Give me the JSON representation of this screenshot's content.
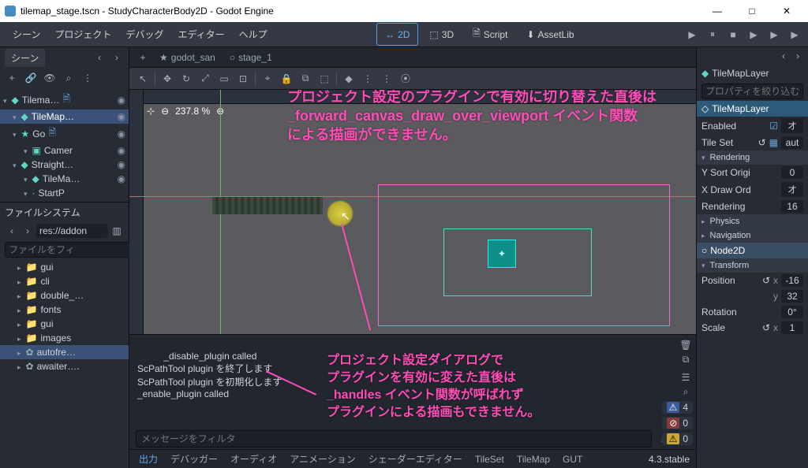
{
  "title": "tilemap_stage.tscn - StudyCharacterBody2D - Godot Engine",
  "window_controls": {
    "min": "—",
    "max": "□",
    "close": "✕"
  },
  "menu": [
    "シーン",
    "プロジェクト",
    "デバッグ",
    "エディター",
    "ヘルプ"
  ],
  "modes": {
    "d2": "2D",
    "d3": "3D",
    "script": "Script",
    "assetlib": "AssetLib"
  },
  "play_icons": [
    "▶",
    "⏸",
    "■",
    "▶",
    "▶",
    "▶"
  ],
  "scene_dock": {
    "tab": "シーン",
    "tools": [
      "+",
      "🔗",
      "👁",
      "⌕",
      "⋮"
    ],
    "tree": [
      {
        "icon": "◆",
        "label": "Tilema…",
        "indent": 0,
        "script": true,
        "eye": true
      },
      {
        "icon": "◆",
        "label": "TileMap…",
        "indent": 1,
        "sel": true,
        "eye": true
      },
      {
        "icon": "★",
        "label": "Go",
        "indent": 1,
        "script": true,
        "eye": true
      },
      {
        "icon": "▣",
        "label": "Camer",
        "indent": 2,
        "eye": true
      },
      {
        "icon": "◆",
        "label": "Straight…",
        "indent": 1,
        "eye": true
      },
      {
        "icon": "◆",
        "label": "TileMa…",
        "indent": 2,
        "eye": true
      },
      {
        "icon": "·",
        "label": "StartP",
        "indent": 2
      }
    ]
  },
  "fs_dock": {
    "title": "ファイルシステム",
    "path": "res://addon",
    "filter_ph": "ファイルをフィ",
    "items": [
      {
        "t": "folder",
        "label": "gui",
        "open": true
      },
      {
        "t": "folder",
        "label": "cli"
      },
      {
        "t": "folder",
        "label": "double_…"
      },
      {
        "t": "folder",
        "label": "fonts"
      },
      {
        "t": "folder",
        "label": "gui"
      },
      {
        "t": "folder",
        "label": "images"
      },
      {
        "t": "file",
        "label": "autofre…",
        "sel": true
      },
      {
        "t": "file",
        "label": "awaiter…."
      }
    ]
  },
  "center_tabs": [
    {
      "icon": "★",
      "label": "godot_san"
    },
    {
      "icon": "○",
      "label": "stage_1"
    }
  ],
  "vp_tools": [
    "↖",
    "✥",
    "↻",
    "⤢",
    "▭",
    "⊡",
    "⌖",
    "🔒",
    "⧉",
    "⬚",
    "◆",
    "⋮",
    "⋮",
    "⦿"
  ],
  "vp_zoom": {
    "minus": "⊖",
    "pct": "237.8 %",
    "plus": "⊕",
    "center": "⊹"
  },
  "annotation_top": "プロジェクト設定のプラグインで有効に切り替えた直後は\n_forward_canvas_draw_over_viewport イベント関数\nによる描画ができません。",
  "annotation_mid": "プロジェクト設定ダイアログで\nプラグインを有効に変えた直後は\n_handles イベント関数が呼ばれず\nプラグインによる描画もできません。",
  "output": {
    "lines": "_disable_plugin called\nScPathTool plugin を終了します\nScPathTool plugin を初期化します\n_enable_plugin called",
    "filter_ph": "メッセージをフィルタ",
    "badges": [
      {
        "icon": "⚠",
        "color": "#fff",
        "bg": "#3b5b9c",
        "label": "4"
      },
      {
        "icon": "⊘",
        "color": "#fff",
        "bg": "#8a3a3a",
        "label": "0"
      },
      {
        "icon": "⚠",
        "color": "#000",
        "bg": "#caa832",
        "label": "0"
      }
    ],
    "footer": [
      "出力",
      "デバッガー",
      "オーディオ",
      "アニメーション",
      "シェーダーエディター",
      "TileSet",
      "TileMap",
      "GUT"
    ],
    "version": "4.3.stable"
  },
  "inspector": {
    "tab_icon": "◆",
    "title": "TileMapLayer",
    "filter_ph": "プロパティを絞り込む",
    "class_header": "TileMapLayer",
    "rows_top": [
      {
        "label": "Enabled",
        "ctl": "check",
        "val": "オ"
      },
      {
        "label": "Tile Set",
        "ctl": "res",
        "val": "aut",
        "reset": "↺"
      }
    ],
    "group_render": "Rendering",
    "rows_render": [
      {
        "label": "Y Sort Origi",
        "val": "0"
      },
      {
        "label": "X Draw Ord",
        "val": "オ"
      },
      {
        "label": "Rendering",
        "val": "16"
      }
    ],
    "group_phys": "Physics",
    "group_nav": "Navigation",
    "node2d": "Node2D",
    "group_tf": "Transform",
    "rows_tf": [
      {
        "label": "Position",
        "sub": "x",
        "val": "-16",
        "reset": "↺"
      },
      {
        "label": "",
        "sub": "y",
        "val": "32"
      },
      {
        "label": "Rotation",
        "val": "0°"
      },
      {
        "label": "Scale",
        "sub": "x",
        "val": "1",
        "reset": "↺"
      }
    ]
  }
}
